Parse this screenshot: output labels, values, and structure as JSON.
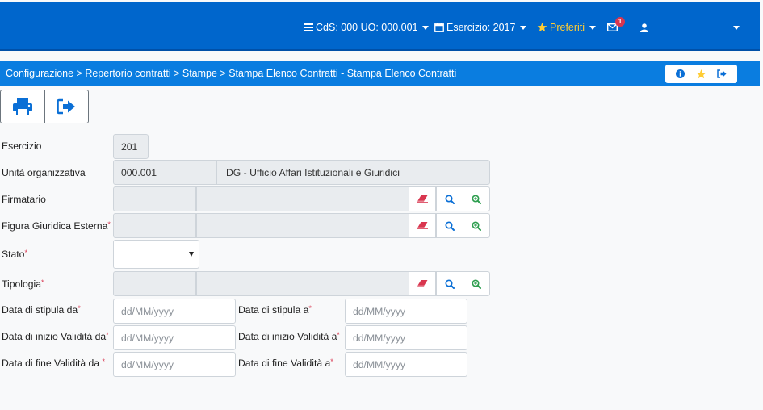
{
  "topbar": {
    "context": "CdS: 000 UO: 000.001",
    "esercizio": "Esercizio: 2017",
    "preferiti": "Preferiti",
    "notifications_count": "1"
  },
  "breadcrumb": {
    "path": "Configurazione > Repertorio contratti > Stampe > Stampa Elenco Contratti - Stampa Elenco Contratti"
  },
  "form": {
    "esercizio": {
      "label": "Esercizio",
      "value": "201"
    },
    "unita_organizzativa": {
      "label": "Unità organizzativa",
      "code": "000.001",
      "description": "DG - Ufficio Affari Istituzionali e Giuridici"
    },
    "firmatario": {
      "label": "Firmatario"
    },
    "figura_giuridica": {
      "label": "Figura Giuridica Esterna",
      "required": "*"
    },
    "stato": {
      "label": "Stato",
      "required": "*"
    },
    "tipologia": {
      "label": "Tipologia",
      "required": "*"
    },
    "data_stipula_da": {
      "label": "Data di stipula da",
      "required": "*",
      "placeholder": "dd/MM/yyyy"
    },
    "data_stipula_a": {
      "label": "Data di stipula a",
      "required": "*",
      "placeholder": "dd/MM/yyyy"
    },
    "data_inizio_da": {
      "label": "Data di inizio Validità da",
      "required": "*",
      "placeholder": "dd/MM/yyyy"
    },
    "data_inizio_a": {
      "label": "Data di inizio Validità a",
      "required": "*",
      "placeholder": "dd/MM/yyyy"
    },
    "data_fine_da": {
      "label": "Data di fine Validità da ",
      "required": "*",
      "placeholder": "dd/MM/yyyy"
    },
    "data_fine_a": {
      "label": "Data di fine Validità a",
      "required": "*",
      "placeholder": "dd/MM/yyyy"
    }
  },
  "colors": {
    "topbar": "#0066cc",
    "breadcrumb": "#0a7de0",
    "primary_icon": "#0a6fd6",
    "erase_icon": "#d9364f",
    "add_search_icon": "#2e9e4f",
    "favorite": "#ffcc33",
    "required": "#d9364f"
  }
}
